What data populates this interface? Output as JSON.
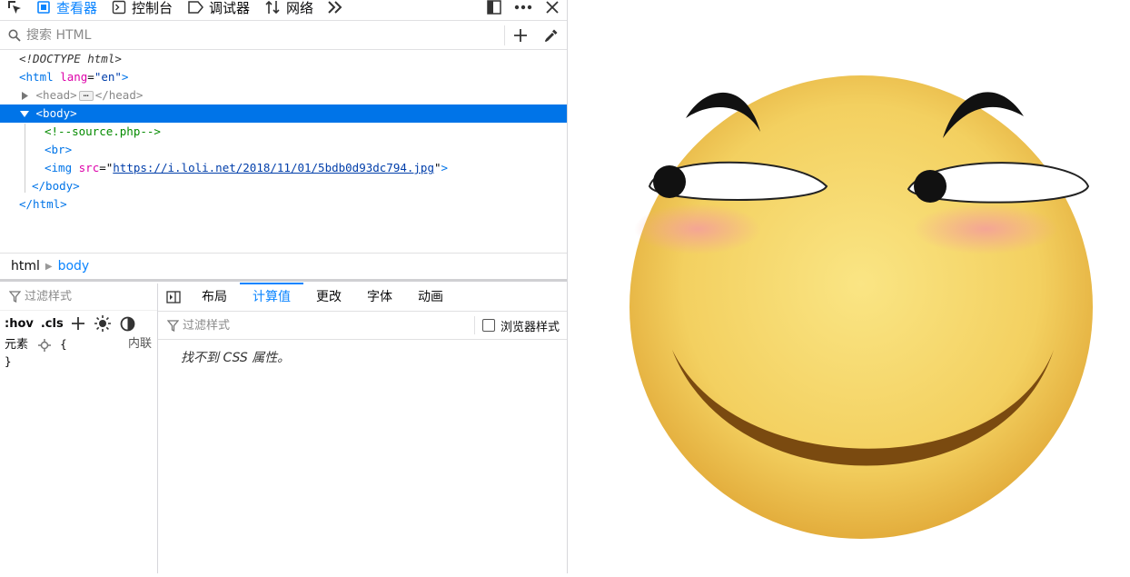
{
  "toolbar": {
    "tabs": [
      {
        "label": "查看器",
        "icon": "inspector-icon"
      },
      {
        "label": "控制台",
        "icon": "console-icon"
      },
      {
        "label": "调试器",
        "icon": "debugger-icon"
      },
      {
        "label": "网络",
        "icon": "network-icon"
      }
    ],
    "active_color": "#0a84ff"
  },
  "search": {
    "placeholder": "搜索 HTML"
  },
  "markup": {
    "doctype": "<!DOCTYPE html>",
    "html_open_tag": "<html",
    "html_attr_name": "lang",
    "html_attr_value": "\"en\"",
    "head_open": "<head>",
    "head_close": "</head>",
    "body_open": "<body>",
    "comment": "<!--source.php-->",
    "br": "<br>",
    "img_tag": "<img",
    "img_attr": "src",
    "img_src": "https://i.loli.net/2018/11/01/5bdb0d93dc794.jpg",
    "body_close": "</body>",
    "html_close": "</html>"
  },
  "breadcrumb": {
    "items": [
      "html",
      "body"
    ]
  },
  "rules": {
    "filter_placeholder": "过滤样式",
    "hov": ":hov",
    "cls": ".cls",
    "element_label": "元素",
    "open_brace": "{",
    "close_brace": "}",
    "inline_label": "内联"
  },
  "computed": {
    "tabs": [
      "布局",
      "计算值",
      "更改",
      "字体",
      "动画"
    ],
    "active_tab": "计算值",
    "filter_placeholder": "过滤样式",
    "browser_styles_label": "浏览器样式",
    "empty_message": "找不到 CSS 属性。"
  },
  "preview": {
    "face_color": "#f3d060",
    "brow_color": "#111111",
    "mouth_color": "#7a4a10"
  }
}
